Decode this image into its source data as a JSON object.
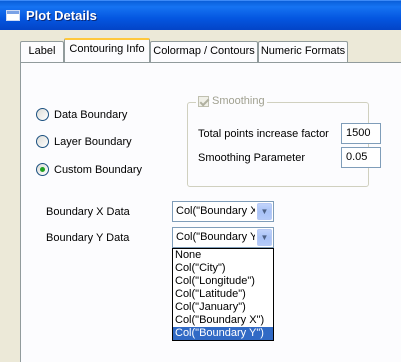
{
  "window": {
    "title": "Plot Details"
  },
  "tabs": [
    {
      "label": "Label"
    },
    {
      "label": "Contouring Info"
    },
    {
      "label": "Colormap / Contours"
    },
    {
      "label": "Numeric Formats"
    }
  ],
  "boundary_options": {
    "data_boundary": "Data Boundary",
    "layer_boundary": "Layer Boundary",
    "custom_boundary": "Custom Boundary",
    "selected": "Custom Boundary"
  },
  "smoothing": {
    "label": "Smoothing",
    "checked": true,
    "enabled": false,
    "points_factor_label": "Total points increase factor",
    "points_factor_value": "1500",
    "parameter_label": "Smoothing Parameter",
    "parameter_value": "0.05"
  },
  "boundary_x": {
    "label": "Boundary X Data",
    "value": "Col(\"Boundary X\")"
  },
  "boundary_y": {
    "label": "Boundary Y Data",
    "value": "Col(\"Boundary Y\")",
    "options": [
      "None",
      "Col(\"City\")",
      "Col(\"Longitude\")",
      "Col(\"Latitude\")",
      "Col(\"January\")",
      "Col(\"Boundary X\")",
      "Col(\"Boundary Y\")"
    ],
    "highlighted_option": "Col(\"Boundary Y\")"
  },
  "colors": {
    "titlebar": "#0a5fd9",
    "active_tab_accent": "#ffc83c",
    "selection": "#316ac5"
  }
}
